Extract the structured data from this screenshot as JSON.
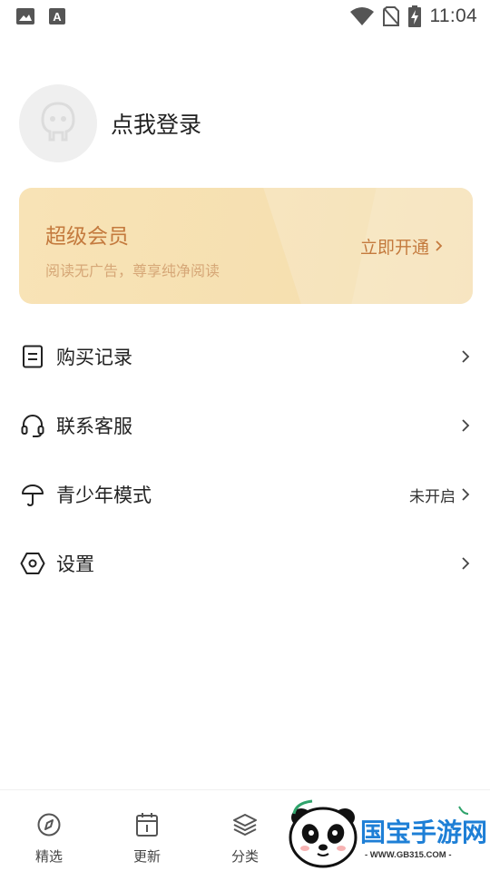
{
  "status_bar": {
    "time": "11:04",
    "icons": [
      "image-icon",
      "text-icon",
      "wifi-icon",
      "no-sim-icon",
      "battery-charging-icon"
    ]
  },
  "profile": {
    "login_text": "点我登录",
    "avatar_icon": "default-avatar-icon"
  },
  "vip": {
    "title": "超级会员",
    "subtitle": "阅读无广告，尊享纯净阅读",
    "action": "立即开通",
    "action_icon": "chevron-right-icon",
    "colors": {
      "accent": "#c47a3e",
      "background": "#f8e3b6"
    }
  },
  "menu": [
    {
      "label": "购买记录",
      "icon": "document-icon",
      "status": ""
    },
    {
      "label": "联系客服",
      "icon": "headset-icon",
      "status": ""
    },
    {
      "label": "青少年模式",
      "icon": "umbrella-icon",
      "status": "未开启"
    },
    {
      "label": "设置",
      "icon": "hexagon-settings-icon",
      "status": ""
    }
  ],
  "tabs": [
    {
      "label": "精选",
      "icon": "compass-icon"
    },
    {
      "label": "更新",
      "icon": "calendar-icon"
    },
    {
      "label": "分类",
      "icon": "layers-icon"
    }
  ],
  "watermark": {
    "brand": "国宝手游网",
    "url": "- WWW.GB315.COM -"
  }
}
